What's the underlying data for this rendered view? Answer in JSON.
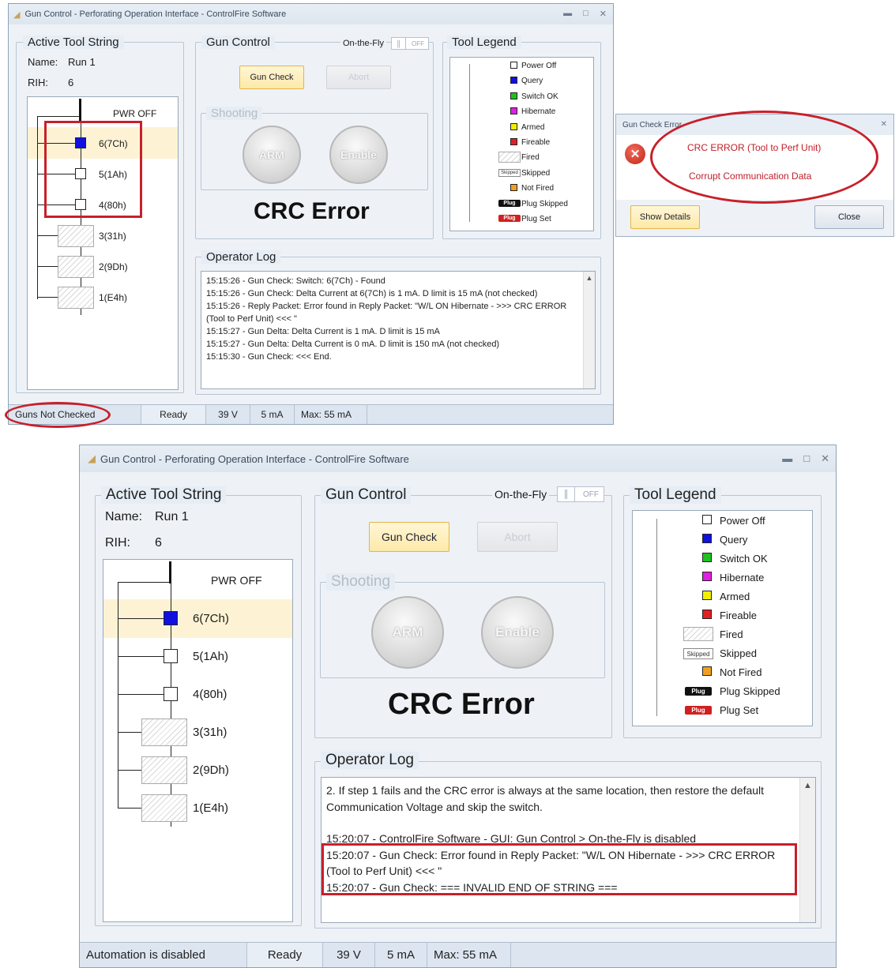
{
  "top": {
    "title": "Gun Control - Perforating Operation Interface - ControlFire Software",
    "active": {
      "header": "Active Tool String",
      "name_label": "Name:",
      "name_value": "Run 1",
      "rih_label": "RIH:",
      "rih_value": "6",
      "pwr": "PWR OFF",
      "tools": [
        "6(7Ch)",
        "5(1Ah)",
        "4(80h)",
        "3(31h)",
        "2(9Dh)",
        "1(E4h)"
      ]
    },
    "gun_control": {
      "header": "Gun Control",
      "on_the_fly": "On-the-Fly",
      "toggle_state": "OFF",
      "gun_check": "Gun Check",
      "abort": "Abort",
      "shooting": "Shooting",
      "arm": "ARM",
      "enable": "Enable",
      "status_big": "CRC Error"
    },
    "legend": {
      "header": "Tool Legend",
      "items": [
        "Power Off",
        "Query",
        "Switch OK",
        "Hibernate",
        "Armed",
        "Fireable",
        "Fired",
        "Skipped",
        "Not Fired",
        "Plug Skipped",
        "Plug Set"
      ]
    },
    "log": {
      "header": "Operator Log",
      "lines": [
        "15:15:26 - Gun Check: Switch: 6(7Ch) - Found",
        "15:15:26 - Gun Check: Delta Current at 6(7Ch) is 1 mA. D limit is 15 mA (not checked)",
        "15:15:26 - Reply Packet: Error found in Reply Packet: \"W/L ON Hibernate - >>> CRC ERROR (Tool to Perf Unit) <<< \"",
        "15:15:27 - Gun Delta: Delta Current is 1 mA. D limit is 15 mA",
        "15:15:27 - Gun Delta: Delta Current is 0 mA. D limit is 150 mA (not checked)",
        "15:15:30 - Gun Check: <<< End."
      ]
    },
    "status": {
      "left": "Guns Not Checked",
      "ready": "Ready",
      "voltage": "39 V",
      "current": "5 mA",
      "max": "Max: 55 mA"
    }
  },
  "dialog": {
    "title": "Gun Check Error",
    "line1": "CRC ERROR (Tool to Perf Unit)",
    "line2": "Corrupt Communication Data",
    "details": "Show Details",
    "close": "Close"
  },
  "bottom": {
    "title": "Gun Control - Perforating Operation Interface - ControlFire Software",
    "active": {
      "header": "Active Tool String",
      "name_label": "Name:",
      "name_value": "Run 1",
      "rih_label": "RIH:",
      "rih_value": "6",
      "pwr": "PWR OFF",
      "tools": [
        "6(7Ch)",
        "5(1Ah)",
        "4(80h)",
        "3(31h)",
        "2(9Dh)",
        "1(E4h)"
      ]
    },
    "gun_control": {
      "header": "Gun Control",
      "on_the_fly": "On-the-Fly",
      "toggle_state": "OFF",
      "gun_check": "Gun Check",
      "abort": "Abort",
      "shooting": "Shooting",
      "arm": "ARM",
      "enable": "Enable",
      "status_big": "CRC Error"
    },
    "legend": {
      "header": "Tool Legend",
      "items": [
        "Power Off",
        "Query",
        "Switch OK",
        "Hibernate",
        "Armed",
        "Fireable",
        "Fired",
        "Skipped",
        "Not Fired",
        "Plug Skipped",
        "Plug Set"
      ]
    },
    "log": {
      "header": "Operator Log",
      "lines": [
        "2. If step 1 fails and the CRC error is always at the same location, then restore the default Communication Voltage and skip the switch.",
        "",
        "15:20:07 - ControlFire Software - GUI: Gun Control > On-the-Fly is disabled",
        "15:20:07 - Gun Check:  Error found in Reply Packet: \"W/L ON Hibernate - >>> CRC ERROR (Tool to Perf Unit) <<< \"",
        "15:20:07 - Gun Check: === INVALID END OF STRING ==="
      ]
    },
    "status": {
      "left": "Automation is disabled",
      "ready": "Ready",
      "voltage": "39 V",
      "current": "5 mA",
      "max": "Max: 55 mA"
    }
  },
  "colors": {
    "query": "#1010e0",
    "switch_ok": "#20c020",
    "hibernate": "#e020e0",
    "armed": "#f0f000",
    "fireable": "#e02020",
    "not_fired": "#f0a020",
    "highlight": "#c8202a"
  }
}
